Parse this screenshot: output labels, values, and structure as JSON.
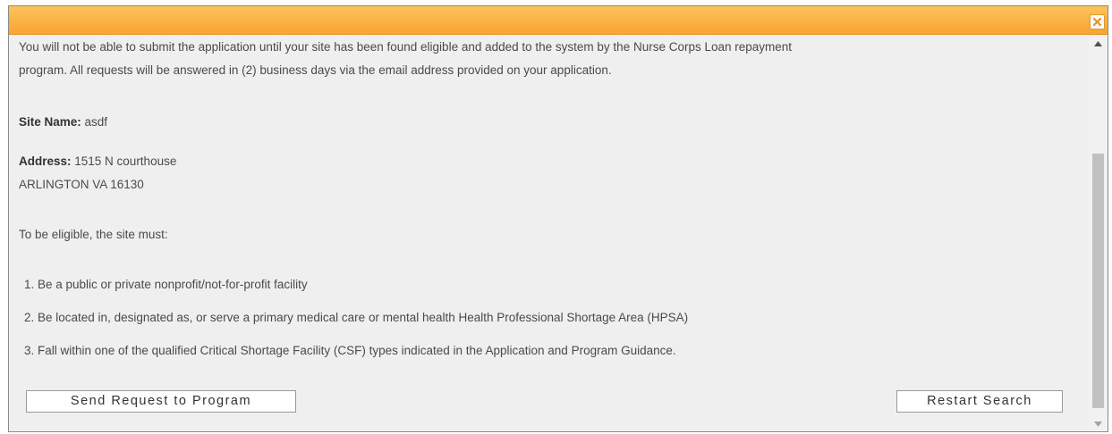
{
  "dialog": {
    "close_icon": "close-x-icon"
  },
  "content": {
    "intro_line1": "You will not be able to submit the application until your site has been found eligible and added to the system by the Nurse Corps Loan repayment",
    "intro_line2": "program. All requests will be answered in (2) business days via the email address provided on your application.",
    "site_name_label": "Site Name:",
    "site_name_value": " asdf",
    "address_label": "Address:",
    "address_line1": " 1515 N courthouse",
    "address_line2": "ARLINGTON VA 16130",
    "eligibility_heading": "To be eligible, the site must:",
    "criteria": [
      "1. Be a public or private nonprofit/not-for-profit facility",
      "2. Be located in, designated as, or serve a primary medical care or mental health Health Professional Shortage Area (HPSA)",
      "3. Fall within one of the qualified Critical Shortage Facility (CSF) types indicated in the Application and Program Guidance."
    ]
  },
  "buttons": {
    "send_request": "Send Request to Program",
    "restart_search": "Restart Search"
  },
  "scrollbar": {
    "up_icon": "scroll-up-arrow-icon",
    "down_icon": "scroll-down-arrow-icon"
  },
  "colors": {
    "title_bar": "#f9ab3b",
    "background": "#efefef",
    "text": "#4a4a4a"
  }
}
